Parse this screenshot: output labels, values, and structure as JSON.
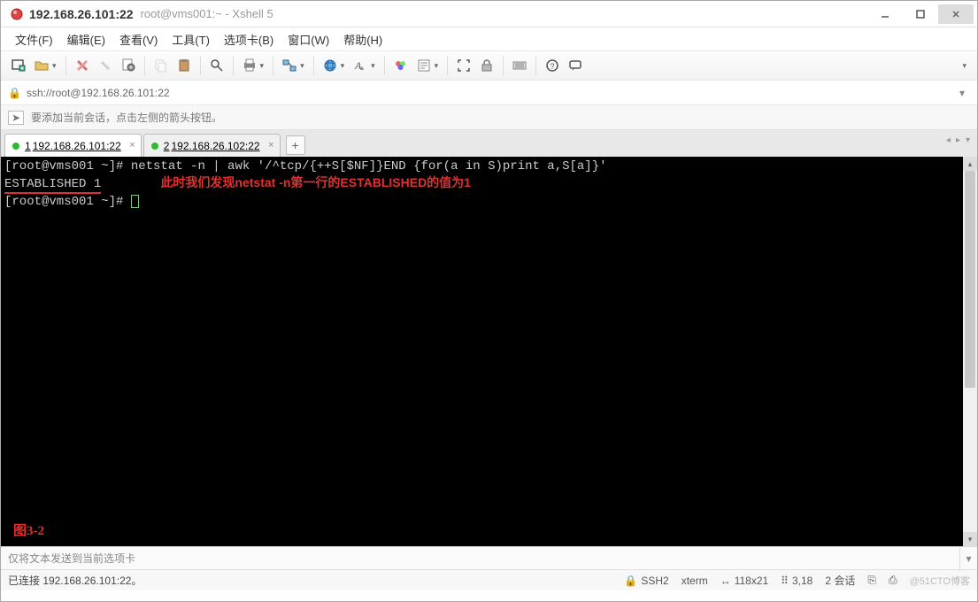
{
  "title": {
    "main": "192.168.26.101:22",
    "sub": "root@vms001:~ - Xshell 5"
  },
  "menu": {
    "file": "文件(F)",
    "edit": "编辑(E)",
    "view": "查看(V)",
    "tools": "工具(T)",
    "tabs": "选项卡(B)",
    "window": "窗口(W)",
    "help": "帮助(H)"
  },
  "addressbar": {
    "url": "ssh://root@192.168.26.101:22"
  },
  "hintbar": {
    "text": "要添加当前会话，点击左侧的箭头按钮。"
  },
  "tabs": [
    {
      "num": "1",
      "label": "192.168.26.101:22",
      "active": true
    },
    {
      "num": "2",
      "label": "192.168.26.102:22",
      "active": false
    }
  ],
  "terminal": {
    "line1_prompt": "[root@vms001 ~]# ",
    "line1_cmd": "netstat -n | awk '/^tcp/{++S[$NF]}END {for(a in S)print a,S[a]}'",
    "line2_state": "ESTABLISHED 1",
    "annotation": "此时我们发现netstat -n第一行的ESTABLISHED的值为1",
    "line3_prompt": "[root@vms001 ~]# ",
    "figure_label": "图3-2"
  },
  "sendbar": {
    "placeholder": "仅将文本发送到当前选项卡"
  },
  "statusbar": {
    "connected": "已连接 192.168.26.101:22。",
    "proto": "SSH2",
    "termtype": "xterm",
    "size": "118x21",
    "pos": "3,18",
    "sessions": "2 会话",
    "watermark": "@51CTO博客"
  }
}
